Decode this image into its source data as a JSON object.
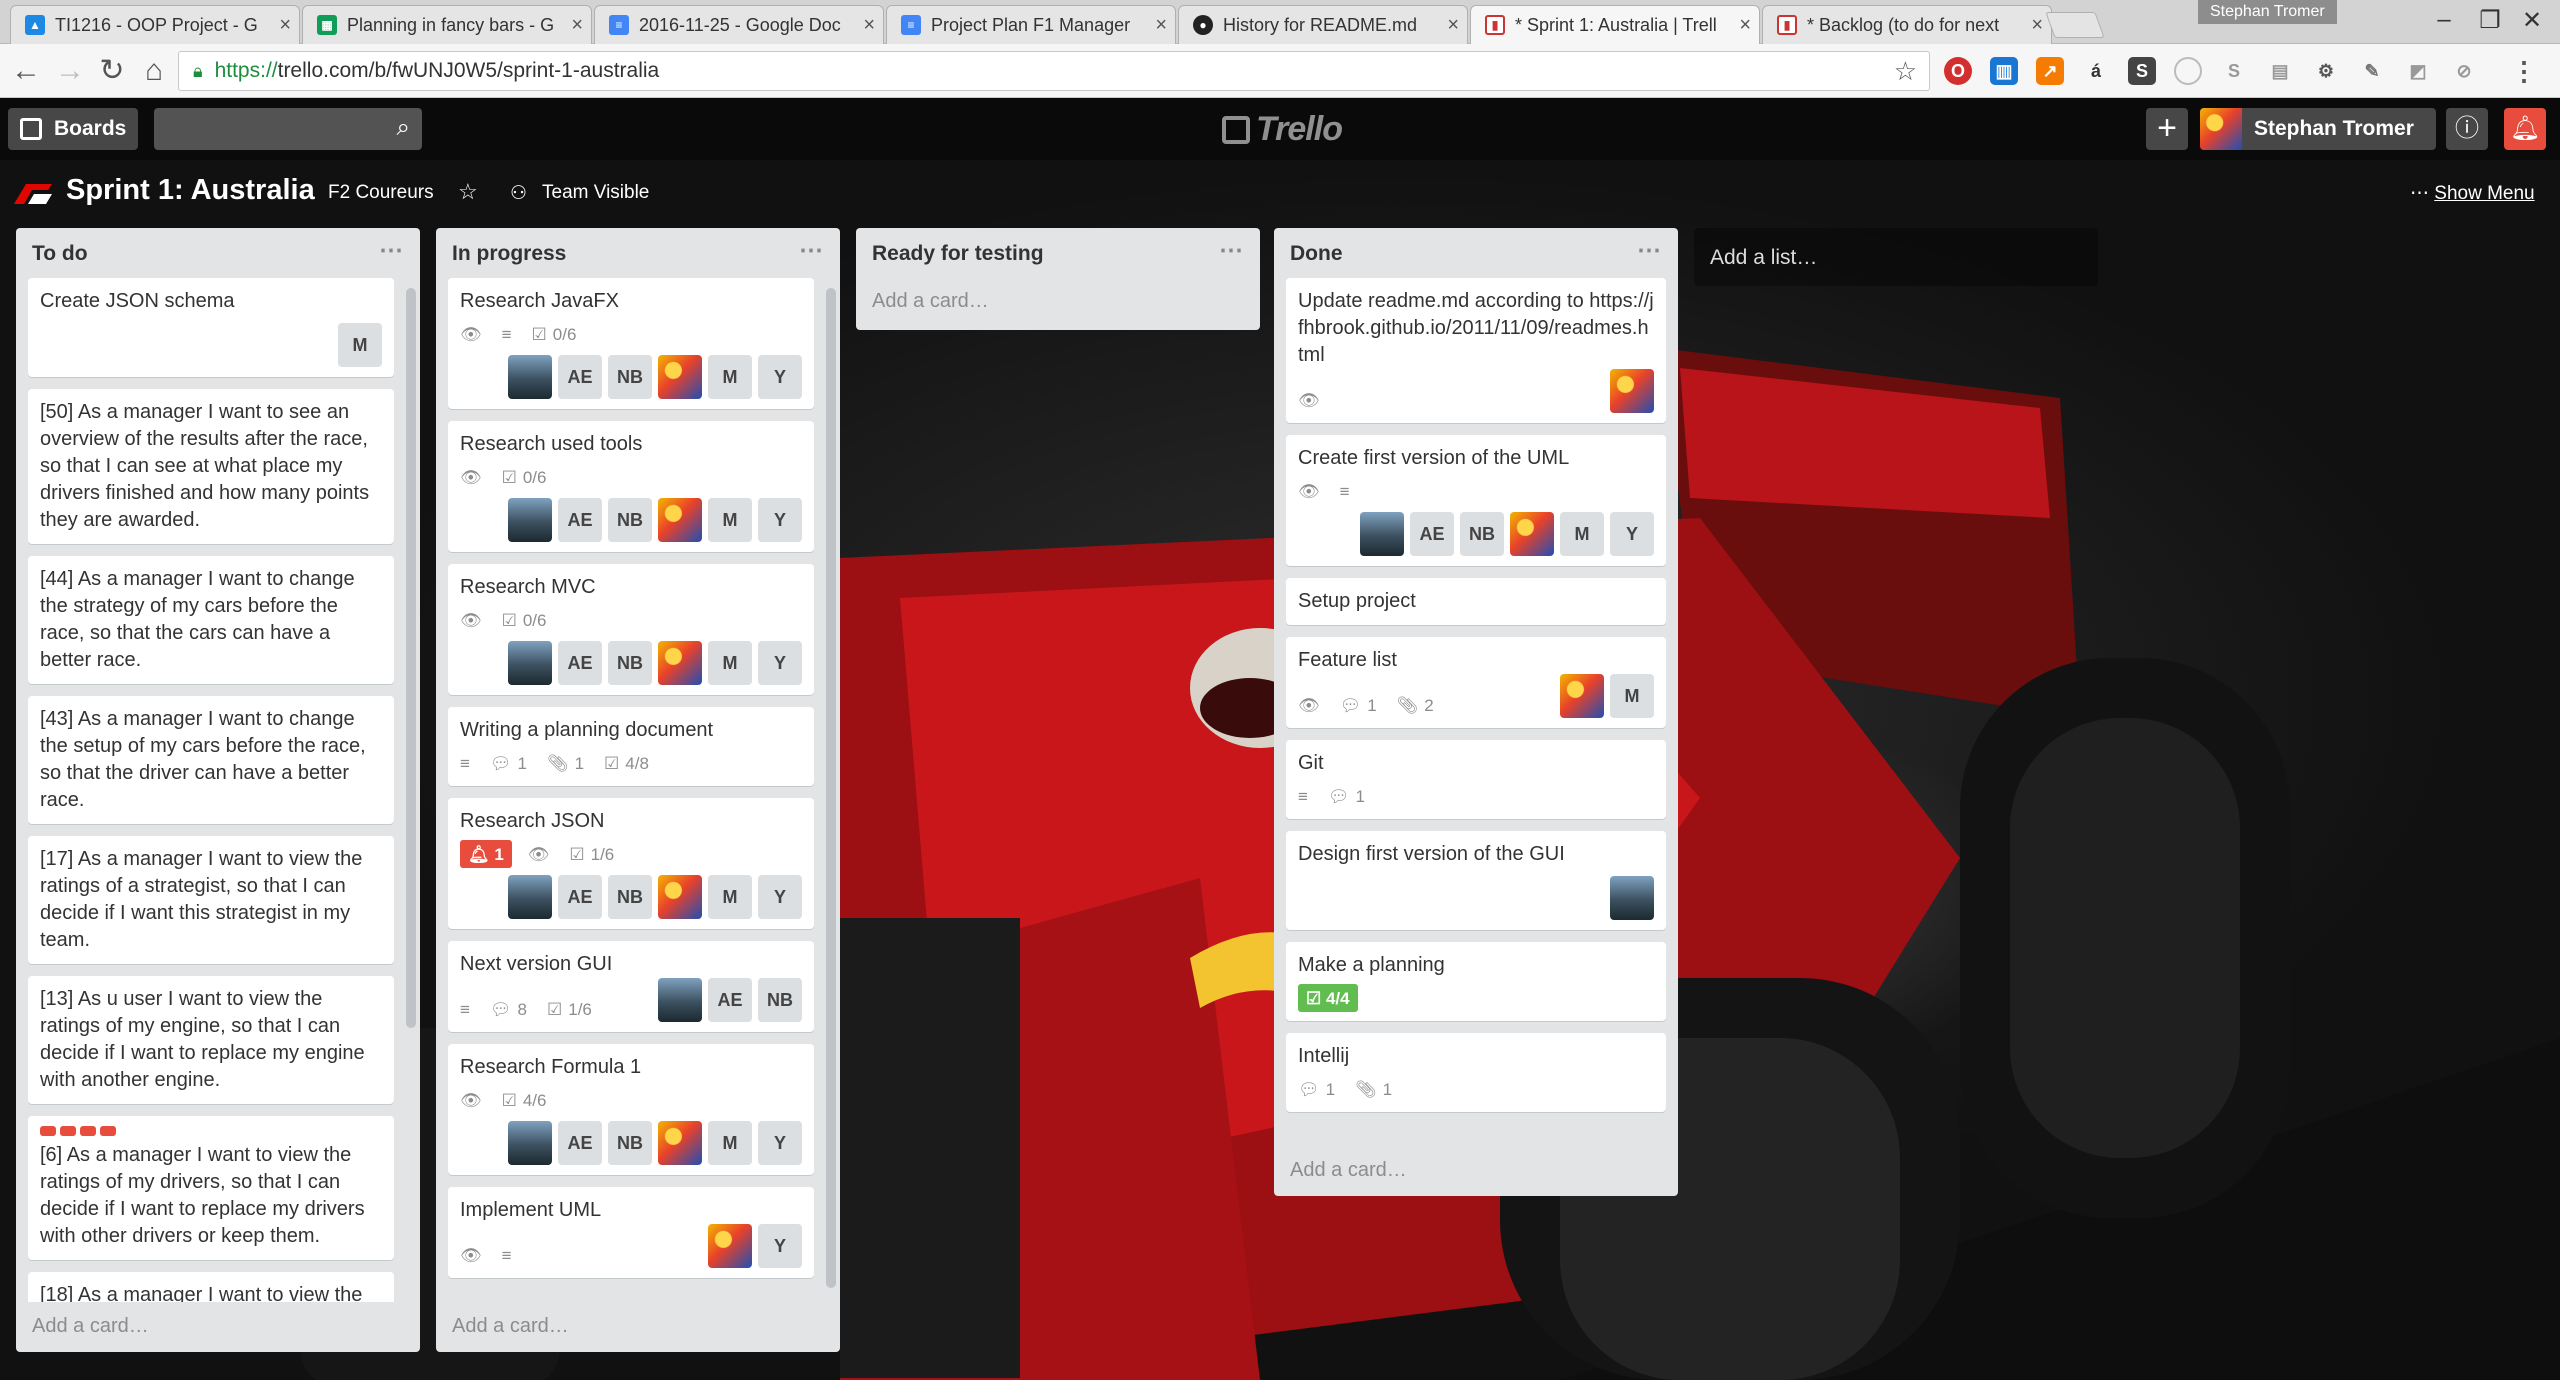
{
  "browser": {
    "tabs": [
      {
        "title": "TI1216 - OOP Project - G",
        "favicon": "drive",
        "color": "#1e88e5"
      },
      {
        "title": "Planning in fancy bars - G",
        "favicon": "sheets",
        "color": "#0f9d58"
      },
      {
        "title": "2016-11-25 - Google Doc",
        "favicon": "docs",
        "color": "#4285f4"
      },
      {
        "title": "Project Plan F1 Manager",
        "favicon": "docs",
        "color": "#4285f4"
      },
      {
        "title": "History for README.md",
        "favicon": "github",
        "color": "#222222"
      },
      {
        "title": "* Sprint 1: Australia | Trell",
        "favicon": "trello",
        "color": "#e0e0e0"
      },
      {
        "title": "* Backlog (to do for next",
        "favicon": "trello",
        "color": "#e0e0e0"
      }
    ],
    "profile": "Stephan Tromer",
    "url_scheme": "https://",
    "url_rest": "trello.com/b/fwUNJ0W5/sprint-1-australia"
  },
  "header": {
    "boards_label": "Boards",
    "logo": "Trello",
    "user_name": "Stephan Tromer"
  },
  "board": {
    "title": "Sprint 1: Australia",
    "team": "F2 Coureurs",
    "visibility": "Team Visible",
    "show_menu": "Show Menu",
    "add_list": "Add a list…",
    "add_card": "Add a card…"
  },
  "lists": {
    "todo": {
      "name": "To do",
      "cards": [
        {
          "title": "Create JSON schema",
          "members": [
            "M"
          ]
        },
        {
          "title": "[50] As a manager I want to see an overview of the results after the race, so that I can see at what place my drivers finished and how many points they are awarded."
        },
        {
          "title": "[44] As a manager I want to change the strategy of my cars before the race, so that the cars can have a better race."
        },
        {
          "title": "[43] As a manager I want to change the setup of my cars before the race, so that the driver can have a better race."
        },
        {
          "title": "[17] As a manager I want to view the ratings of a strategist, so that I can decide if I want this strategist in my team."
        },
        {
          "title": "[13] As u user I want to view the ratings of my engine, so that I can decide if I want to replace my engine with another engine."
        },
        {
          "title": "[6] As a manager I want to view the ratings of my drivers, so that I can decide if I want to replace my drivers with other drivers or keep them."
        },
        {
          "title": "[18] As a manager I want to view the"
        }
      ]
    },
    "progress": {
      "name": "In progress",
      "cards": [
        {
          "title": "Research JavaFX",
          "checklist": "0/6",
          "members": [
            "photo",
            "AE",
            "NB",
            "racer",
            "M",
            "Y"
          ]
        },
        {
          "title": "Research used tools",
          "checklist": "0/6",
          "members": [
            "photo",
            "AE",
            "NB",
            "racer",
            "M",
            "Y"
          ]
        },
        {
          "title": "Research MVC",
          "checklist": "0/6",
          "members": [
            "photo",
            "AE",
            "NB",
            "racer",
            "M",
            "Y"
          ]
        },
        {
          "title": "Writing a planning document",
          "comments": "1",
          "attachments": "1",
          "checklist": "4/8"
        },
        {
          "title": "Research JSON",
          "notif": "1",
          "checklist": "1/6",
          "members": [
            "photo",
            "AE",
            "NB",
            "racer",
            "M",
            "Y"
          ]
        },
        {
          "title": "Next version GUI",
          "comments": "8",
          "checklist": "1/6",
          "members": [
            "photo",
            "AE",
            "NB"
          ]
        },
        {
          "title": "Research Formula 1",
          "checklist": "4/6",
          "members": [
            "photo",
            "AE",
            "NB",
            "racer",
            "M",
            "Y"
          ]
        },
        {
          "title": "Implement UML",
          "members": [
            "racer",
            "Y"
          ]
        }
      ]
    },
    "testing": {
      "name": "Ready for testing"
    },
    "done": {
      "name": "Done",
      "cards": [
        {
          "title": "Update readme.md according to https://jfhbrook.github.io/2011/11/09/readmes.html"
        },
        {
          "title": "Create first version of the UML",
          "members": [
            "photo",
            "AE",
            "NB",
            "racer",
            "M",
            "Y"
          ]
        },
        {
          "title": "Setup project"
        },
        {
          "title": "Feature list",
          "comments": "1",
          "attachments": "2",
          "members": [
            "racer",
            "M"
          ]
        },
        {
          "title": "Git",
          "comments": "1"
        },
        {
          "title": "Design first version of the GUI"
        },
        {
          "title": "Make a planning",
          "checklist": "4/4"
        },
        {
          "title": "Intellij",
          "comments": "1",
          "attachments": "1"
        }
      ]
    }
  },
  "colors": {
    "list_bg": "#e2e4e6",
    "accent_red": "#e74c3c",
    "checklist_green": "#61bd4f",
    "label_red": "#e74c3c"
  }
}
